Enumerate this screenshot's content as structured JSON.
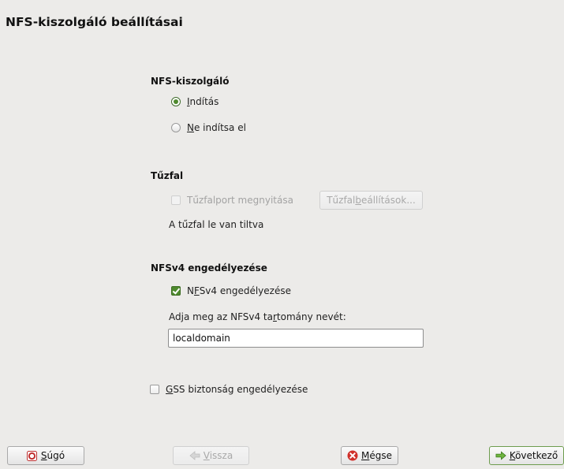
{
  "page": {
    "title": "NFS-kiszolgáló beállításai"
  },
  "nfs_server": {
    "heading": "NFS-kiszolgáló",
    "options": [
      {
        "pre": "",
        "mnemonic": "I",
        "post": "ndítás",
        "selected": true
      },
      {
        "pre": "",
        "mnemonic": "N",
        "post": "e indítsa el",
        "selected": false
      }
    ]
  },
  "firewall": {
    "heading": "Tűzfal",
    "open_port_label": "Tűzfalport megnyitása",
    "settings_button": {
      "pre": "Tűzfal",
      "mnemonic": "b",
      "post": "eállítások..."
    },
    "status": "A tűzfal le van tiltva"
  },
  "nfsv4": {
    "heading": "NFSv4 engedélyezése",
    "checkbox": {
      "pre": "N",
      "mnemonic": "F",
      "post": "Sv4 engedélyezése",
      "checked": true
    },
    "domain_label": {
      "pre": "Adja meg az NFSv4 ta",
      "mnemonic": "r",
      "post": "tomány nevét:"
    },
    "domain_value": "localdomain"
  },
  "gss": {
    "pre": "",
    "mnemonic": "G",
    "post": "SS biztonság engedélyezése",
    "checked": false
  },
  "buttons": {
    "help": {
      "pre": "",
      "mnemonic": "S",
      "post": "úgó"
    },
    "back": {
      "pre": "",
      "mnemonic": "V",
      "post": "issza"
    },
    "cancel": {
      "pre": "",
      "mnemonic": "M",
      "post": "égse"
    },
    "next": {
      "pre": "",
      "mnemonic": "K",
      "post": "övetkező"
    }
  },
  "colors": {
    "background": "#ecebe9",
    "accent_green": "#4f8a2e",
    "cancel_red": "#d0302a"
  }
}
